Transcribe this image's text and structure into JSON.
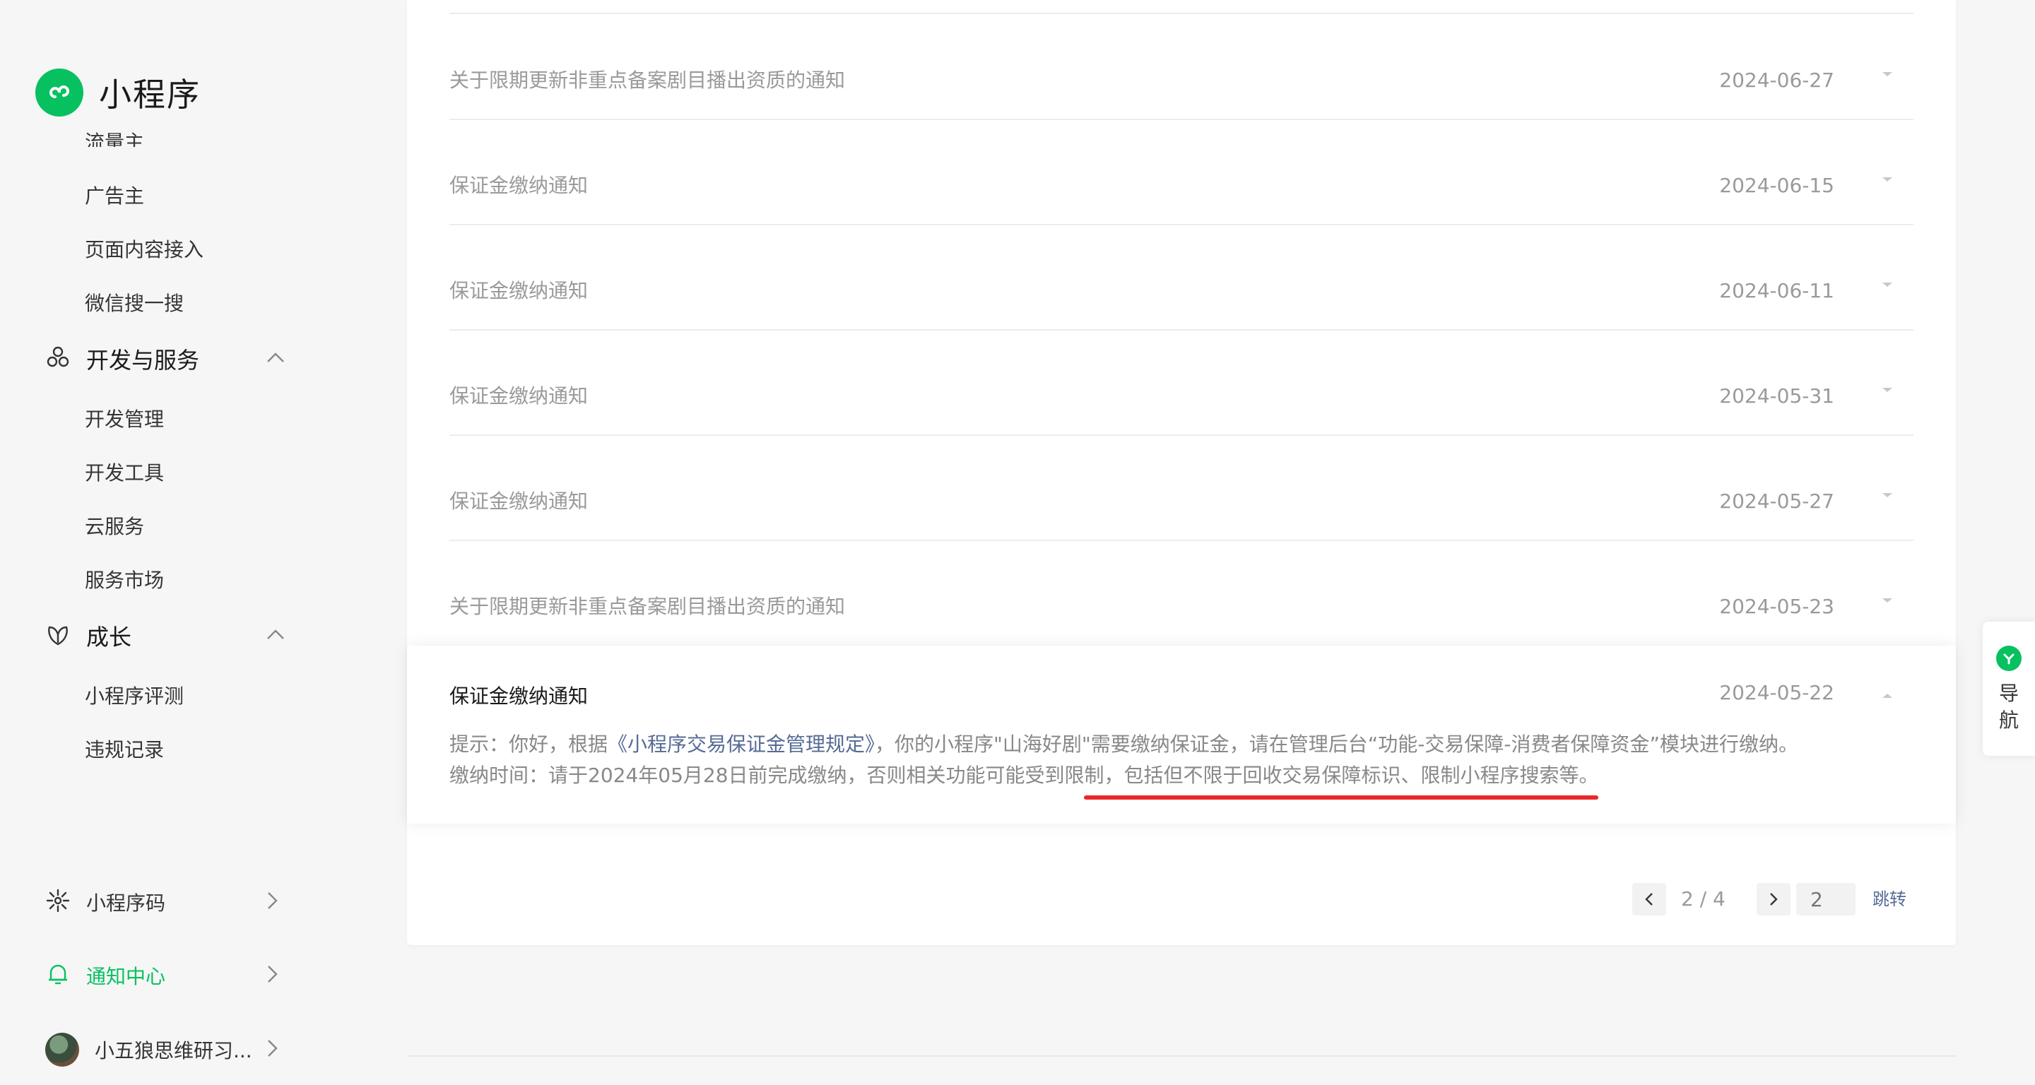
{
  "brand": {
    "title": "小程序",
    "logo_icon": "miniprogram-logo-icon",
    "color": "#07c160"
  },
  "sidebar": {
    "cut_item": "流量主",
    "items_top": [
      "广告主",
      "页面内容接入",
      "微信搜一搜"
    ],
    "group_dev": {
      "label": "开发与服务",
      "icon": "cluster-icon",
      "items": [
        "开发管理",
        "开发工具",
        "云服务",
        "服务市场"
      ]
    },
    "group_growth": {
      "label": "成长",
      "icon": "growth-icon",
      "items": [
        "小程序评测",
        "违规记录"
      ]
    },
    "bottom": {
      "qrcode_label": "小程序码",
      "notify_label": "通知中心",
      "user_label": "小五狼思维研习..."
    }
  },
  "notices": [
    {
      "title": "关于限期更新非重点备案剧目播出资质的通知",
      "date": "2024-06-27"
    },
    {
      "title": "保证金缴纳通知",
      "date": "2024-06-15"
    },
    {
      "title": "保证金缴纳通知",
      "date": "2024-06-11"
    },
    {
      "title": "保证金缴纳通知",
      "date": "2024-05-31"
    },
    {
      "title": "保证金缴纳通知",
      "date": "2024-05-27"
    },
    {
      "title": "关于限期更新非重点备案剧目播出资质的通知",
      "date": "2024-05-23"
    }
  ],
  "expanded": {
    "title": "保证金缴纳通知",
    "date": "2024-05-22",
    "line1_prefix": "提示：你好，根据",
    "line1_link": "《小程序交易保证金管理规定》",
    "line1_suffix": "，你的小程序\"山海好剧\"需要缴纳保证金，请在管理后台“功能-交易保障-消费者保障资金”模块进行缴纳。",
    "line2": "缴纳时间：请于2024年05月28日前完成缴纳，否则相关功能可能受到限制，包括但不限于回收交易保障标识、限制小程序搜索等。",
    "highlight_color": "#e8282a"
  },
  "pager": {
    "page_info": "2 / 4",
    "input_placeholder": "2",
    "jump_label": "跳转"
  },
  "float_nav": {
    "line1": "导",
    "line2": "航"
  },
  "colors": {
    "link": "#576b95",
    "accent": "#07c160"
  }
}
